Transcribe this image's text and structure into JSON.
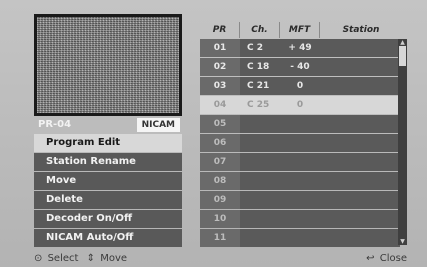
{
  "preview": {
    "pr_label": "PR-04",
    "audio_badge": "NICAM"
  },
  "menu": {
    "items": [
      {
        "label": "Program Edit"
      },
      {
        "label": "Station Rename"
      },
      {
        "label": "Move"
      },
      {
        "label": "Delete"
      },
      {
        "label": "Decoder On/Off"
      },
      {
        "label": "NICAM Auto/Off"
      }
    ],
    "selected_index": 0
  },
  "table": {
    "headers": {
      "pr": "PR",
      "ch": "Ch.",
      "mft": "MFT",
      "station": "Station"
    },
    "rows": [
      {
        "pr": "01",
        "ch": "C 2",
        "mft": "+ 49",
        "station": ""
      },
      {
        "pr": "02",
        "ch": "C 18",
        "mft": "- 40",
        "station": ""
      },
      {
        "pr": "03",
        "ch": "C 21",
        "mft": "0",
        "station": ""
      },
      {
        "pr": "04",
        "ch": "C 25",
        "mft": "0",
        "station": ""
      },
      {
        "pr": "05",
        "ch": "",
        "mft": "",
        "station": ""
      },
      {
        "pr": "06",
        "ch": "",
        "mft": "",
        "station": ""
      },
      {
        "pr": "07",
        "ch": "",
        "mft": "",
        "station": ""
      },
      {
        "pr": "08",
        "ch": "",
        "mft": "",
        "station": ""
      },
      {
        "pr": "09",
        "ch": "",
        "mft": "",
        "station": ""
      },
      {
        "pr": "10",
        "ch": "",
        "mft": "",
        "station": ""
      },
      {
        "pr": "11",
        "ch": "",
        "mft": "",
        "station": ""
      }
    ],
    "highlighted_index": 3
  },
  "footer": {
    "select_label": "Select",
    "move_label": "Move",
    "close_label": "Close",
    "select_icon": "circle-select-icon",
    "move_icon": "up-down-arrows-icon",
    "close_icon": "return-arrow-icon"
  }
}
